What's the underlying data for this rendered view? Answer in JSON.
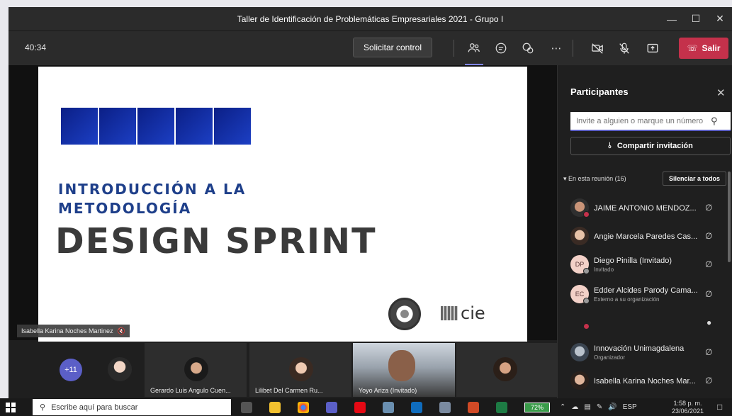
{
  "window": {
    "title": "Taller de Identificación de Problemáticas Empresariales 2021 - Grupo I"
  },
  "toolbar": {
    "timer": "40:34",
    "control_label": "Solicitar control",
    "leave_label": "Salir",
    "icons": [
      "participants-icon",
      "chat-icon",
      "reactions-icon",
      "more-icon",
      "camera-off-icon",
      "mic-off-icon",
      "share-tray-icon"
    ]
  },
  "slide": {
    "intro_line1": "INTRODUCCIÓN A LA",
    "intro_line2": "METODOLOGÍA",
    "title": "DESIGN SPRINT",
    "logo_text": "cie",
    "colors": {
      "blocks": "#1c3fc4",
      "intro": "#1e3f8a",
      "title": "#3a3a3a"
    }
  },
  "presenter": {
    "name": "Isabella Karina Noches Martinez"
  },
  "strip": {
    "more_count": "+11",
    "tiles": [
      {
        "name": "Gerardo Luis Angulo Cuen..."
      },
      {
        "name": "Lilibet Del Carmen Ru..."
      },
      {
        "name": "Yoyo Ariza (Invitado)"
      }
    ]
  },
  "panel": {
    "title": "Participantes",
    "search_placeholder": "Invite a alguien o marque un número",
    "share_label": "Compartir invitación",
    "section_label": "En esta reunión (16)",
    "mute_all_label": "Silenciar a todos",
    "participants": [
      {
        "name": "JAIME ANTONIO MENDOZ...",
        "sub": "",
        "initials": ""
      },
      {
        "name": "Angie Marcela Paredes Cas...",
        "sub": "",
        "initials": ""
      },
      {
        "name": "Diego Pinilla (Invitado)",
        "sub": "Invitado",
        "initials": "DP"
      },
      {
        "name": "Edder Alcides Parody Cama...",
        "sub": "Externo a su organización",
        "initials": "EC"
      },
      {
        "name": "",
        "sub": "",
        "initials": ""
      },
      {
        "name": "Innovación Unimagdalena",
        "sub": "Organizador",
        "initials": ""
      },
      {
        "name": "Isabella Karina Noches Mar...",
        "sub": "",
        "initials": ""
      }
    ]
  },
  "taskbar": {
    "search_placeholder": "Escribe aquí para buscar",
    "battery": "72%",
    "lang": "ESP",
    "time": "1:58 p. m.",
    "date": "23/06/2021"
  }
}
